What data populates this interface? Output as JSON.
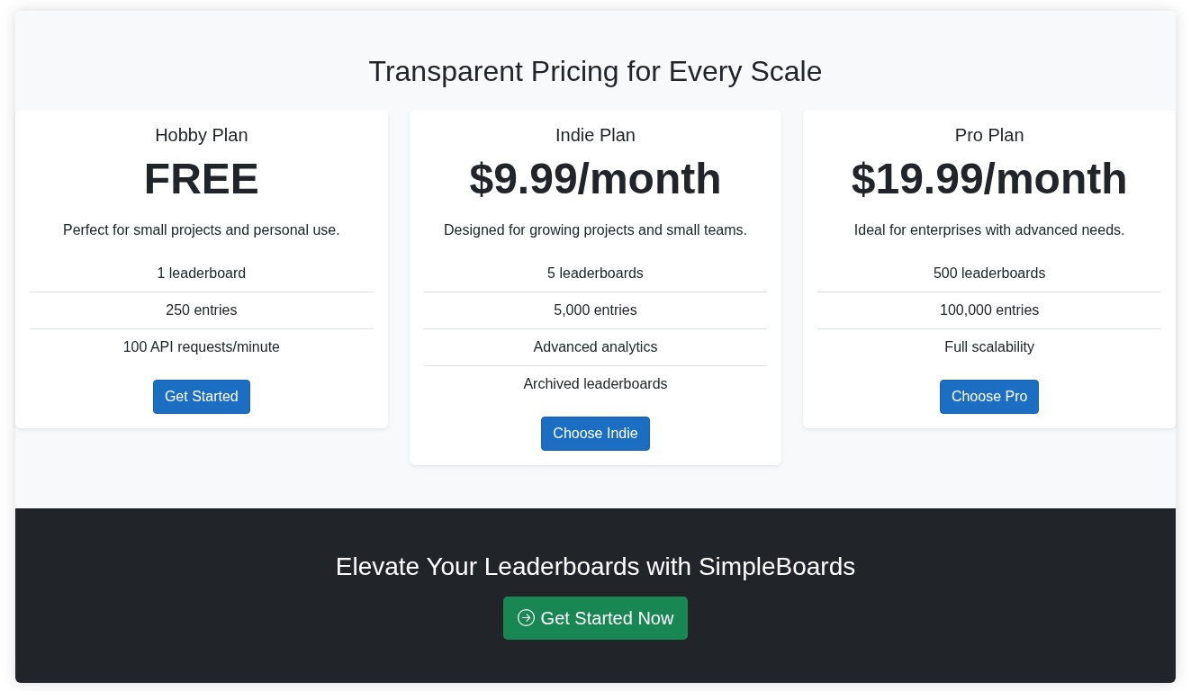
{
  "pricing": {
    "title": "Transparent Pricing for Every Scale",
    "plans": [
      {
        "name": "Hobby Plan",
        "price": "FREE",
        "description": "Perfect for small projects and personal use.",
        "features": [
          "1 leaderboard",
          "250 entries",
          "100 API requests/minute"
        ],
        "button": "Get Started"
      },
      {
        "name": "Indie Plan",
        "price": "$9.99/month",
        "description": "Designed for growing projects and small teams.",
        "features": [
          "5 leaderboards",
          "5,000 entries",
          "Advanced analytics",
          "Archived leaderboards"
        ],
        "button": "Choose Indie"
      },
      {
        "name": "Pro Plan",
        "price": "$19.99/month",
        "description": "Ideal for enterprises with advanced needs.",
        "features": [
          "500 leaderboards",
          "100,000 entries",
          "Full scalability"
        ],
        "button": "Choose Pro"
      }
    ]
  },
  "cta": {
    "title": "Elevate Your Leaderboards with SimpleBoards",
    "button": "Get Started Now"
  }
}
